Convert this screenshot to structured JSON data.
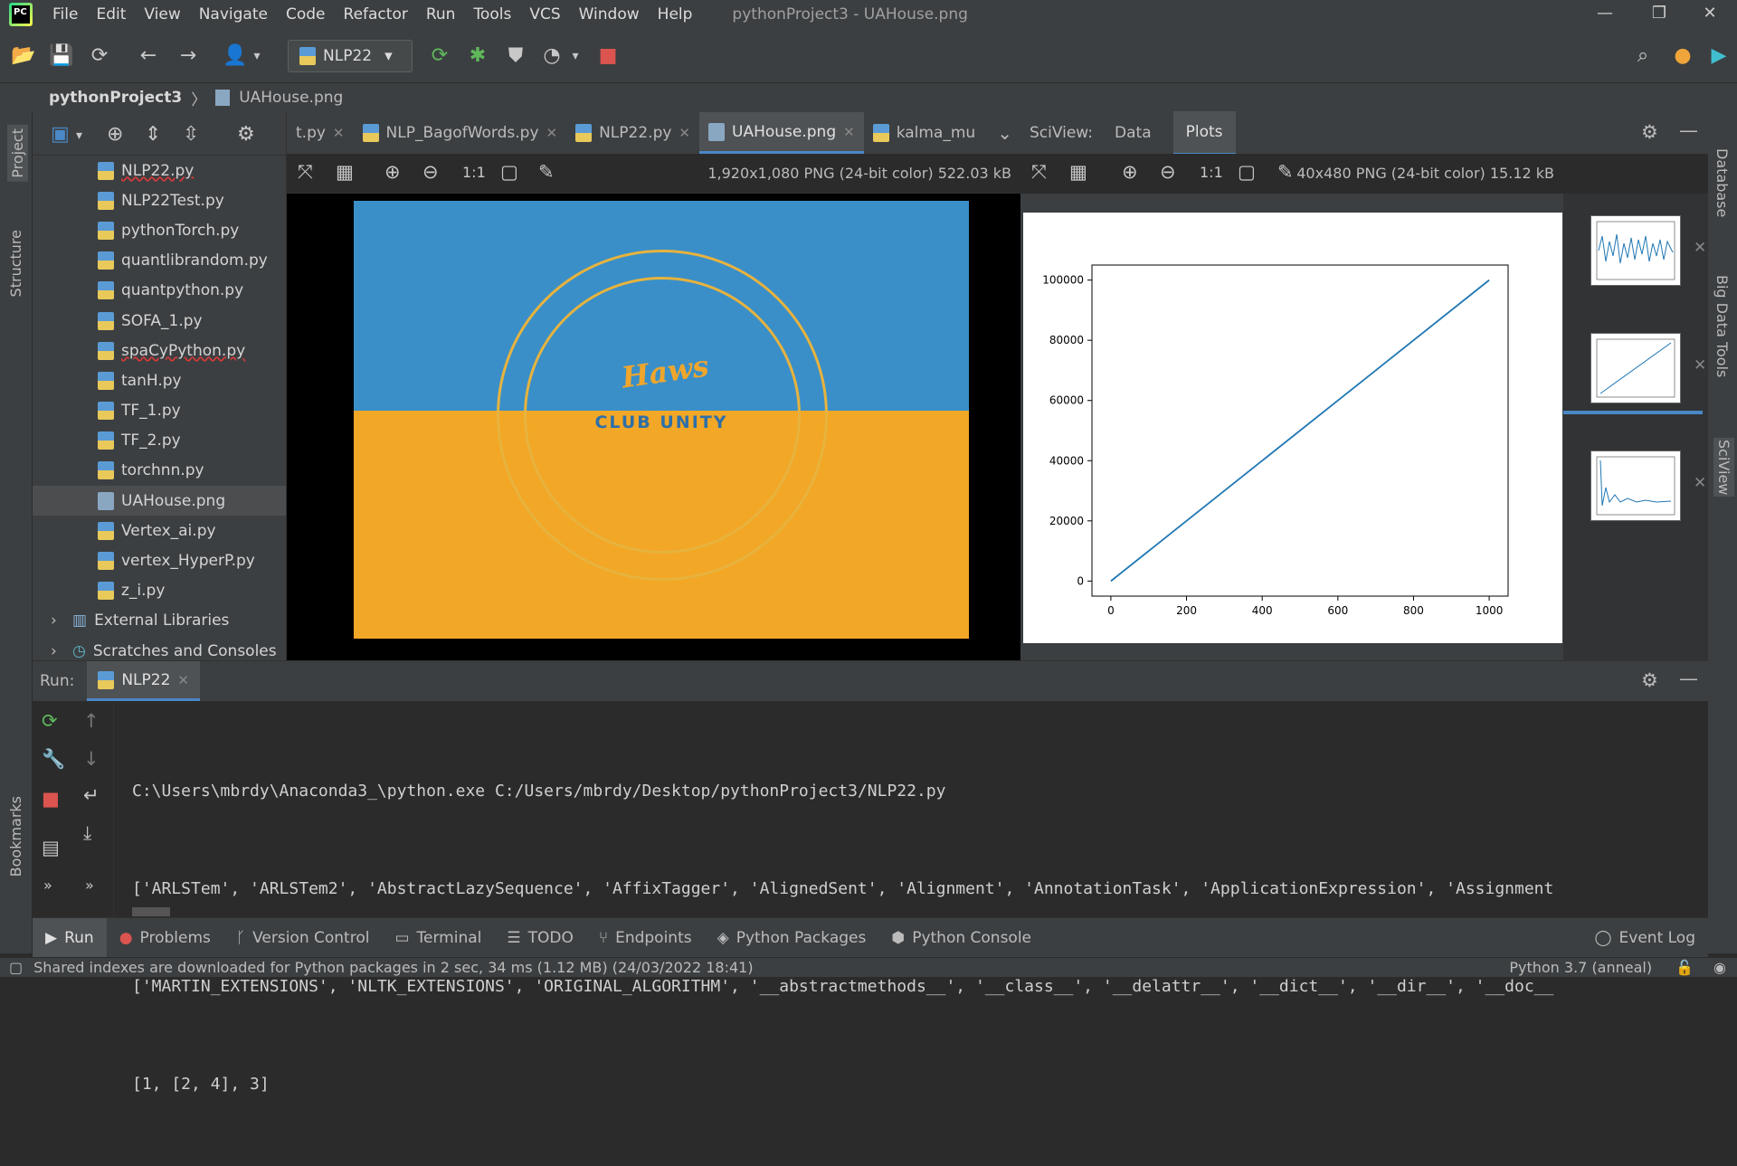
{
  "menu": [
    "File",
    "Edit",
    "View",
    "Navigate",
    "Code",
    "Refactor",
    "Run",
    "Tools",
    "VCS",
    "Window",
    "Help"
  ],
  "window_title": "pythonProject3 - UAHouse.png",
  "toolbar": {
    "run_config": "NLP22"
  },
  "breadcrumb": {
    "project": "pythonProject3",
    "file": "UAHouse.png"
  },
  "left_strip": {
    "project": "Project",
    "structure": "Structure",
    "bookmarks": "Bookmarks"
  },
  "right_strip": {
    "database": "Database",
    "bigdata": "Big Data Tools",
    "sciview": "SciView"
  },
  "files": [
    {
      "name": "NLP22.py",
      "wavy": true
    },
    {
      "name": "NLP22Test.py"
    },
    {
      "name": "pythonTorch.py"
    },
    {
      "name": "quantlibrandom.py"
    },
    {
      "name": "quantpython.py"
    },
    {
      "name": "SOFA_1.py"
    },
    {
      "name": "spaCyPython.py",
      "wavy": true
    },
    {
      "name": "tanH.py"
    },
    {
      "name": "TF_1.py"
    },
    {
      "name": "TF_2.py"
    },
    {
      "name": "torchnn.py"
    },
    {
      "name": "UAHouse.png",
      "selected": true
    },
    {
      "name": "Vertex_ai.py"
    },
    {
      "name": "vertex_HyperP.py"
    },
    {
      "name": "z_i.py"
    }
  ],
  "project_extra": {
    "libraries": "External Libraries",
    "scratches": "Scratches and Consoles"
  },
  "tabs": [
    {
      "label": "t.py"
    },
    {
      "label": "NLP_BagofWords.py"
    },
    {
      "label": "NLP22.py"
    },
    {
      "label": "UAHouse.png",
      "active": true
    },
    {
      "label": "kalma_mu"
    }
  ],
  "image_viewer": {
    "info": "1,920x1,080 PNG (24-bit color) 522.03 kB",
    "zoom_label": "1:1",
    "brand_text": "Haws",
    "club_text": "CLUB UNITY"
  },
  "sciview": {
    "label": "SciView:",
    "tab_data": "Data",
    "tab_plots": "Plots",
    "info": "40x480 PNG (24-bit color) 15.12 kB",
    "zoom_label": "1:1"
  },
  "chart_data": {
    "type": "line",
    "x": [
      0,
      1000
    ],
    "y": [
      0,
      100000
    ],
    "xlim": [
      -50,
      1050
    ],
    "ylim": [
      -5000,
      105000
    ],
    "xticks": [
      0,
      200,
      400,
      600,
      800,
      1000
    ],
    "yticks": [
      0,
      20000,
      40000,
      60000,
      80000,
      100000
    ],
    "xtick_labels": [
      "0",
      "200",
      "400",
      "600",
      "800",
      "1000"
    ],
    "ytick_labels": [
      "0",
      "20000",
      "40000",
      "60000",
      "80000",
      "100000"
    ],
    "color": "#1f77b4"
  },
  "run": {
    "label": "Run:",
    "tab": "NLP22",
    "console": [
      "C:\\Users\\mbrdy\\Anaconda3_\\python.exe C:/Users/mbrdy/Desktop/pythonProject3/NLP22.py",
      "['ARLSTem', 'ARLSTem2', 'AbstractLazySequence', 'AffixTagger', 'AlignedSent', 'Alignment', 'AnnotationTask', 'ApplicationExpression', 'Assignment",
      "['MARTIN_EXTENSIONS', 'NLTK_EXTENSIONS', 'ORIGINAL_ALGORITHM', '__abstractmethods__', '__class__', '__delattr__', '__dict__', '__dir__', '__doc__",
      "[1, [2, 4], 3]"
    ]
  },
  "bottom_tools": [
    "Run",
    "Problems",
    "Version Control",
    "Terminal",
    "TODO",
    "Endpoints",
    "Python Packages",
    "Python Console"
  ],
  "event_log": "Event Log",
  "status": {
    "message": "Shared indexes are downloaded for Python packages in 2 sec, 34 ms (1.12 MB) (24/03/2022 18:41)",
    "interpreter": "Python 3.7 (anneal)"
  }
}
